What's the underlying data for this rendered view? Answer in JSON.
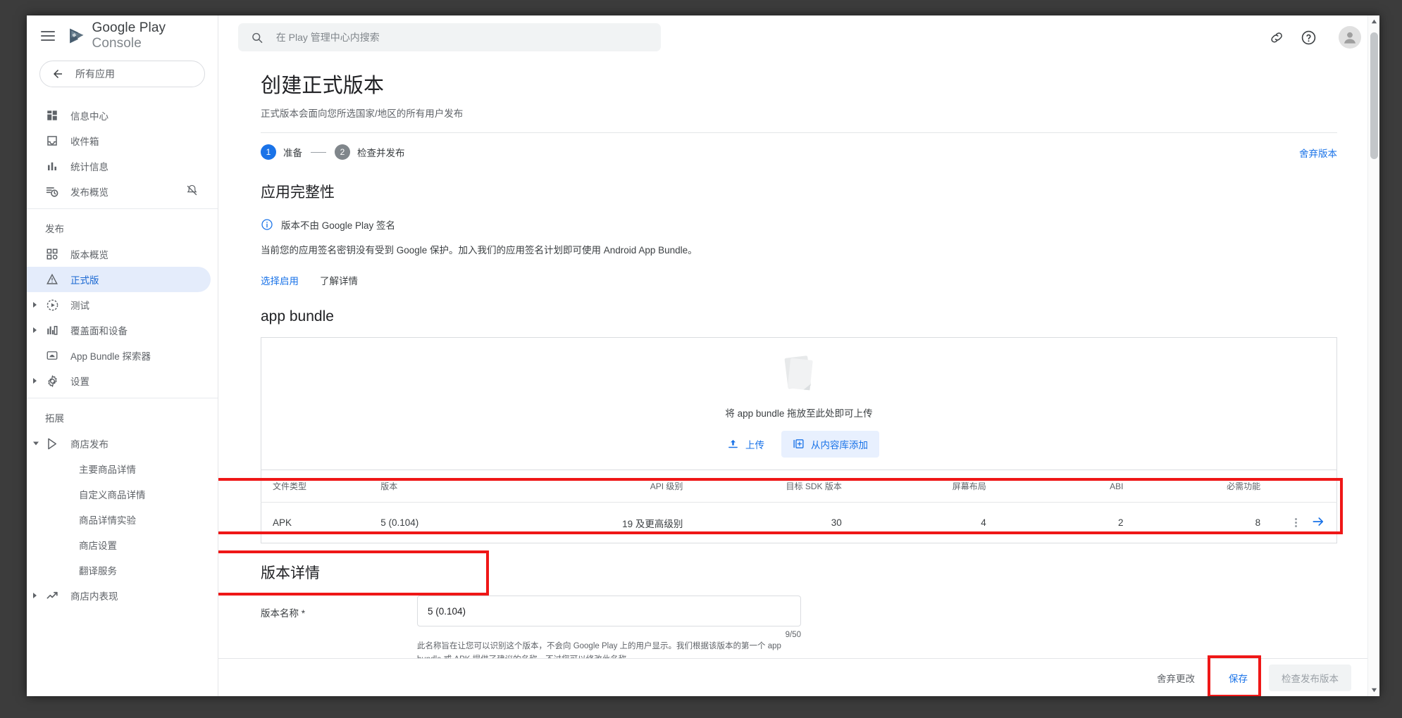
{
  "brand": {
    "name_primary": "Google Play",
    "name_secondary": "Console"
  },
  "sidebar": {
    "all_apps_label": "所有应用",
    "groups": [
      {
        "title": null,
        "items": [
          {
            "label": "信息中心",
            "icon": "dashboard-icon",
            "expandable": false,
            "active": false
          },
          {
            "label": "收件箱",
            "icon": "inbox-icon",
            "expandable": false,
            "active": false
          },
          {
            "label": "统计信息",
            "icon": "stats-icon",
            "expandable": false,
            "active": false
          },
          {
            "label": "发布概览",
            "icon": "release-overview-icon",
            "expandable": false,
            "active": false,
            "trailing_icon": "notifications-off-icon"
          }
        ]
      },
      {
        "title": "发布",
        "items": [
          {
            "label": "版本概览",
            "icon": "releases-overview-icon",
            "expandable": false,
            "active": false
          },
          {
            "label": "正式版",
            "icon": "production-icon",
            "expandable": false,
            "active": true
          },
          {
            "label": "测试",
            "icon": "testing-icon",
            "expandable": true,
            "expanded": false,
            "active": false
          },
          {
            "label": "覆盖面和设备",
            "icon": "reach-devices-icon",
            "expandable": true,
            "expanded": false,
            "active": false
          },
          {
            "label": "App Bundle 探索器",
            "icon": "app-bundle-explorer-icon",
            "expandable": false,
            "active": false
          },
          {
            "label": "设置",
            "icon": "gear-icon",
            "expandable": true,
            "expanded": false,
            "active": false
          }
        ]
      },
      {
        "title": "拓展",
        "items": [
          {
            "label": "商店发布",
            "icon": "play-store-icon",
            "expandable": true,
            "expanded": true,
            "active": false
          },
          {
            "label": "主要商品详情",
            "icon": null,
            "sub": true,
            "active": false
          },
          {
            "label": "自定义商品详情",
            "icon": null,
            "sub": true,
            "active": false
          },
          {
            "label": "商品详情实验",
            "icon": null,
            "sub": true,
            "active": false
          },
          {
            "label": "商店设置",
            "icon": null,
            "sub": true,
            "active": false
          },
          {
            "label": "翻译服务",
            "icon": null,
            "sub": true,
            "active": false
          },
          {
            "label": "商店内表现",
            "icon": "trend-up-icon",
            "expandable": true,
            "expanded": false,
            "active": false
          }
        ]
      }
    ]
  },
  "topbar": {
    "search_placeholder": "在 Play 管理中心内搜索",
    "search_value": "",
    "link_icon": "link-icon",
    "help_icon": "help-circle-icon",
    "avatar_icon": "account-avatar"
  },
  "page": {
    "title": "创建正式版本",
    "subtitle": "正式版本会面向您所选国家/地区的所有用户发布",
    "discard_version_label": "舍弃版本",
    "steps": [
      {
        "number": "1",
        "label": "准备",
        "state": "current"
      },
      {
        "number": "2",
        "label": "检查并发布",
        "state": "next"
      }
    ]
  },
  "integrity": {
    "heading": "应用完整性",
    "info_icon": "info-circle-icon",
    "info_text": "版本不由 Google Play 签名",
    "body": "当前您的应用签名密钥没有受到 Google 保护。加入我们的应用签名计划即可使用 Android App Bundle。",
    "links": [
      {
        "label": "选择启用",
        "style": "primary"
      },
      {
        "label": "了解详情",
        "style": "muted"
      }
    ]
  },
  "bundle": {
    "heading": "app bundle",
    "dropzone_text": "将 app bundle 拖放至此处即可上传",
    "upload_button": {
      "label": "上传",
      "icon": "upload-icon"
    },
    "library_button": {
      "label": "从内容库添加",
      "icon": "library-add-icon"
    },
    "table": {
      "headers": [
        "文件类型",
        "版本",
        "API 级别",
        "目标 SDK 版本",
        "屏幕布局",
        "ABI",
        "必需功能"
      ],
      "rows": [
        {
          "file_type": "APK",
          "version": "5 (0.104)",
          "api_level": "19 及更高级别",
          "target_sdk": "30",
          "screen_layouts": "4",
          "abi": "2",
          "required_features": "8",
          "kebab_icon": "more-vert-icon",
          "arrow_icon": "arrow-right-icon"
        }
      ]
    }
  },
  "release_details": {
    "heading": "版本详情",
    "name_label": "版本名称 *",
    "name_value": "5 (0.104)",
    "name_placeholder": "",
    "counter": "9/50",
    "helper": "此名称旨在让您可以识别这个版本，不会向 Google Play 上的用户显示。我们根据该版本的第一个 app bundle 或 APK 提供了建议的名称，不过您可以修改此名称。"
  },
  "footer": {
    "discard_changes": "舍弃更改",
    "save": "保存",
    "review_release": "检查发布版本"
  },
  "colors": {
    "accent_blue": "#1a73e8",
    "active_nav_bg": "#e4ecfb",
    "annotation_red": "#ef1717",
    "muted_text": "#5f6368"
  }
}
